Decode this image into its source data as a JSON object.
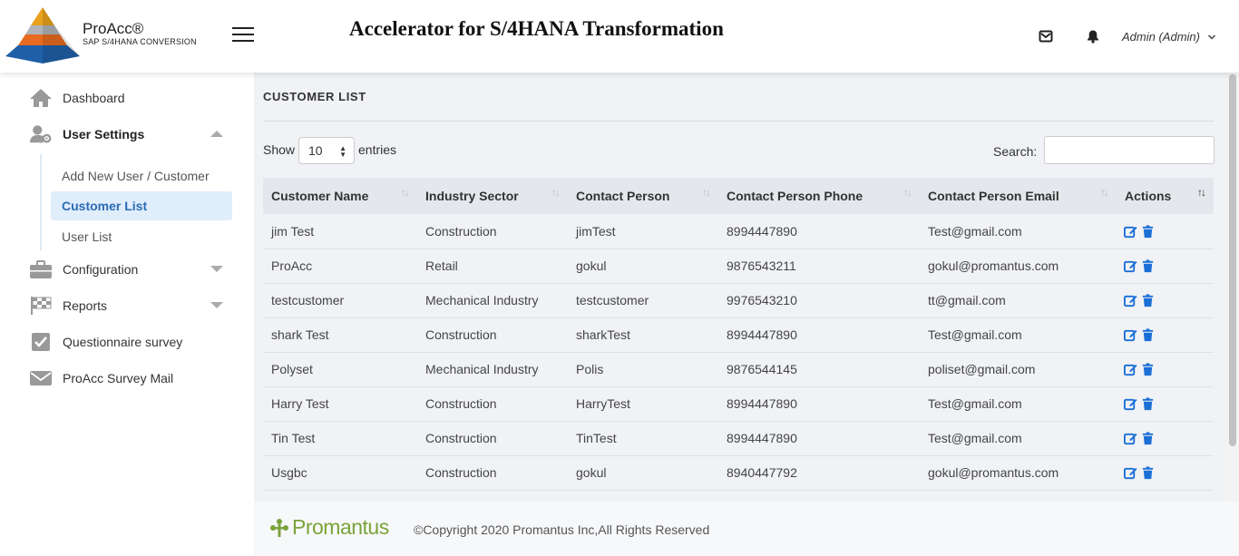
{
  "header": {
    "brand_name": "ProAcc®",
    "brand_sub": "SAP S/4HANA CONVERSION",
    "title": "Accelerator for S/4HANA Transformation",
    "user": "Admin (Admin)",
    "icons": [
      "menu-icon",
      "mail-icon",
      "bell-icon",
      "chevron-down-icon"
    ]
  },
  "sidebar": {
    "items": [
      {
        "label": "Dashboard",
        "icon": "home-icon"
      },
      {
        "label": "User Settings",
        "icon": "user-gear-icon"
      },
      {
        "label": "Configuration",
        "icon": "briefcase-icon"
      },
      {
        "label": "Reports",
        "icon": "flag-icon"
      },
      {
        "label": "Questionnaire survey",
        "icon": "checkbox-icon"
      },
      {
        "label": "ProAcc Survey Mail",
        "icon": "envelope-icon"
      }
    ],
    "sub_items": [
      {
        "label": "Add New User / Customer"
      },
      {
        "label": "Customer List"
      },
      {
        "label": "User List"
      }
    ]
  },
  "main": {
    "page_title": "CUSTOMER LIST",
    "show_label": "Show",
    "show_value": "10",
    "entries_label": "entries",
    "search_label": "Search:",
    "search_value": "",
    "columns": [
      "Customer Name",
      "Industry Sector",
      "Contact Person",
      "Contact Person Phone",
      "Contact Person Email",
      "Actions"
    ],
    "rows": [
      [
        "jim Test",
        "Construction",
        "jimTest",
        "8994447890",
        "Test@gmail.com"
      ],
      [
        "ProAcc",
        "Retail",
        "gokul",
        "9876543211",
        "gokul@promantus.com"
      ],
      [
        "testcustomer",
        "Mechanical Industry",
        "testcustomer",
        "9976543210",
        "tt@gmail.com"
      ],
      [
        "shark Test",
        "Construction",
        "sharkTest",
        "8994447890",
        "Test@gmail.com"
      ],
      [
        "Polyset",
        "Mechanical Industry",
        "Polis",
        "9876544145",
        "poliset@gmail.com"
      ],
      [
        "Harry Test",
        "Construction",
        "HarryTest",
        "8994447890",
        "Test@gmail.com"
      ],
      [
        "Tin Test",
        "Construction",
        "TinTest",
        "8994447890",
        "Test@gmail.com"
      ],
      [
        "Usgbc",
        "Construction",
        "gokul",
        "8940447792",
        "gokul@promantus.com"
      ]
    ]
  },
  "footer": {
    "logo_text": "Promantus",
    "copyright": "©Copyright 2020 Promantus Inc,All Rights Reserved"
  },
  "colors": {
    "accent": "#2a6bb5",
    "action_icon": "#1a6fd6",
    "footer_logo": "#7aa33a",
    "main_bg": "#f0f2f5"
  }
}
